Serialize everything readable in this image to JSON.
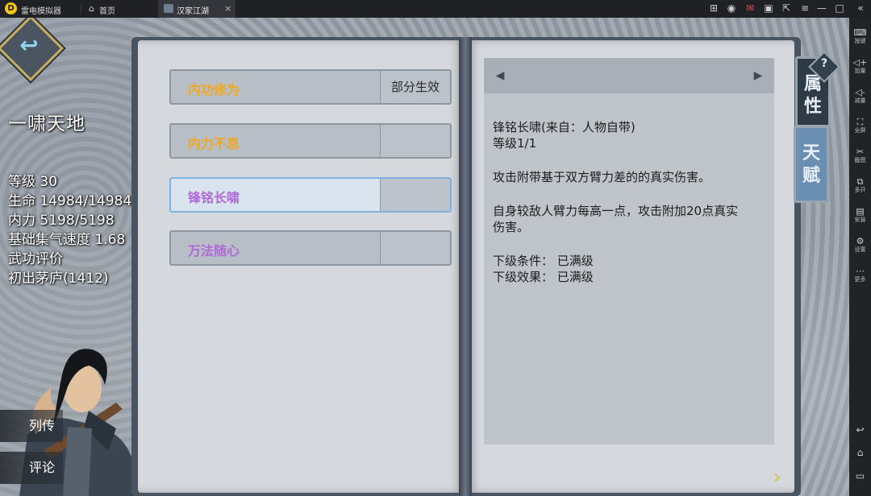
{
  "titlebar": {
    "app_name": "雷电模拟器",
    "home_tab": "首页",
    "game_tab": "汉家江湖",
    "tab_close": "×",
    "controls": [
      "gamepad-icon",
      "user-icon",
      "mail-icon",
      "skin-icon",
      "cast-icon",
      "menu-icon",
      "minimize-icon",
      "maximize-icon",
      "close-icon",
      "collapse-icon"
    ]
  },
  "sidebar": {
    "items": [
      {
        "label": "按键",
        "icon": "keyboard-icon"
      },
      {
        "label": "加量",
        "icon": "volume-up-icon"
      },
      {
        "label": "减量",
        "icon": "volume-down-icon"
      },
      {
        "label": "全屏",
        "icon": "fullscreen-icon"
      },
      {
        "label": "截图",
        "icon": "scissors-icon"
      },
      {
        "label": "多开",
        "icon": "multi-instance-icon"
      },
      {
        "label": "安装",
        "icon": "apk-icon"
      },
      {
        "label": "设置",
        "icon": "gear-icon"
      },
      {
        "label": "更多",
        "icon": "more-icon"
      }
    ]
  },
  "character": {
    "name": "一啸天地",
    "stats": [
      "等级 30",
      "生命 14984/14984",
      "内力 5198/5198",
      "基础集气速度 1.68",
      "武功评价",
      "初出茅庐(1412)"
    ]
  },
  "side_buttons": {
    "biography": "列传",
    "comment": "评论"
  },
  "skills": [
    {
      "name": "内功修为",
      "effect": "部分生效",
      "color": "#f0a824"
    },
    {
      "name": "内力不息",
      "effect": "",
      "color": "#f0a824"
    },
    {
      "name": "锋铭长啸",
      "effect": "",
      "color": "#b06ad8",
      "selected": true
    },
    {
      "name": "万法随心",
      "effect": "",
      "color": "#b06ad8"
    }
  ],
  "detail": {
    "title": "锋铭长啸(来自：人物自带)",
    "level": "等级1/1",
    "desc1": "攻击附带基于双方臂力差的的真实伤害。",
    "desc2_line1": "自身较敌人臂力每高一点，攻击附加20点真实",
    "desc2_line2": "伤害。",
    "next_condition": "下级条件：  已满级",
    "next_effect": "下级效果：  已满级"
  },
  "book_tabs": {
    "attributes": "属性",
    "talent": "天赋"
  },
  "help_label": "?"
}
